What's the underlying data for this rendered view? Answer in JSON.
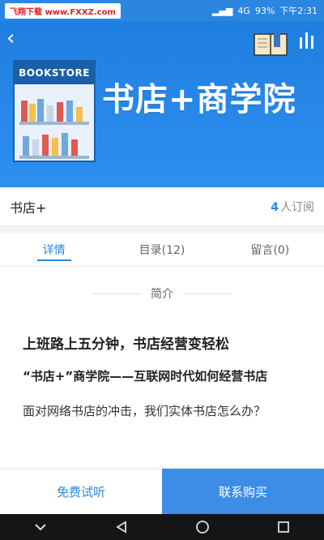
{
  "status_bar": {
    "watermark": "飞翔下载 www.FXXZ.com",
    "signal_label": "4G",
    "battery": "93%",
    "time": "下午2:31"
  },
  "hero": {
    "bookstore_label": "BOOKSTORE",
    "banner_title": "书店+商学院",
    "colors": {
      "background": "#2a86e0"
    }
  },
  "course": {
    "name": "书店+",
    "subscriber_count": "4",
    "subscriber_suffix": "人订阅"
  },
  "tabs": [
    {
      "label": "详情",
      "active": true
    },
    {
      "label": "目录(12)",
      "active": false
    },
    {
      "label": "留言(0)",
      "active": false
    }
  ],
  "section": {
    "title": "简介"
  },
  "content": {
    "heading": "上班路上五分钟，书店经营变轻松",
    "subheading": "“书店+”商学院——互联网时代如何经营书店",
    "paragraph": "面对网络书店的冲击，我们实体书店怎么办？"
  },
  "actions": {
    "trial_label": "免费试听",
    "contact_label": "联系购买"
  },
  "icons": [
    "back-arrow-icon",
    "book-icon",
    "stats-icon",
    "back-nav-icon",
    "home-nav-icon",
    "recents-nav-icon",
    "collapse-nav-icon"
  ]
}
